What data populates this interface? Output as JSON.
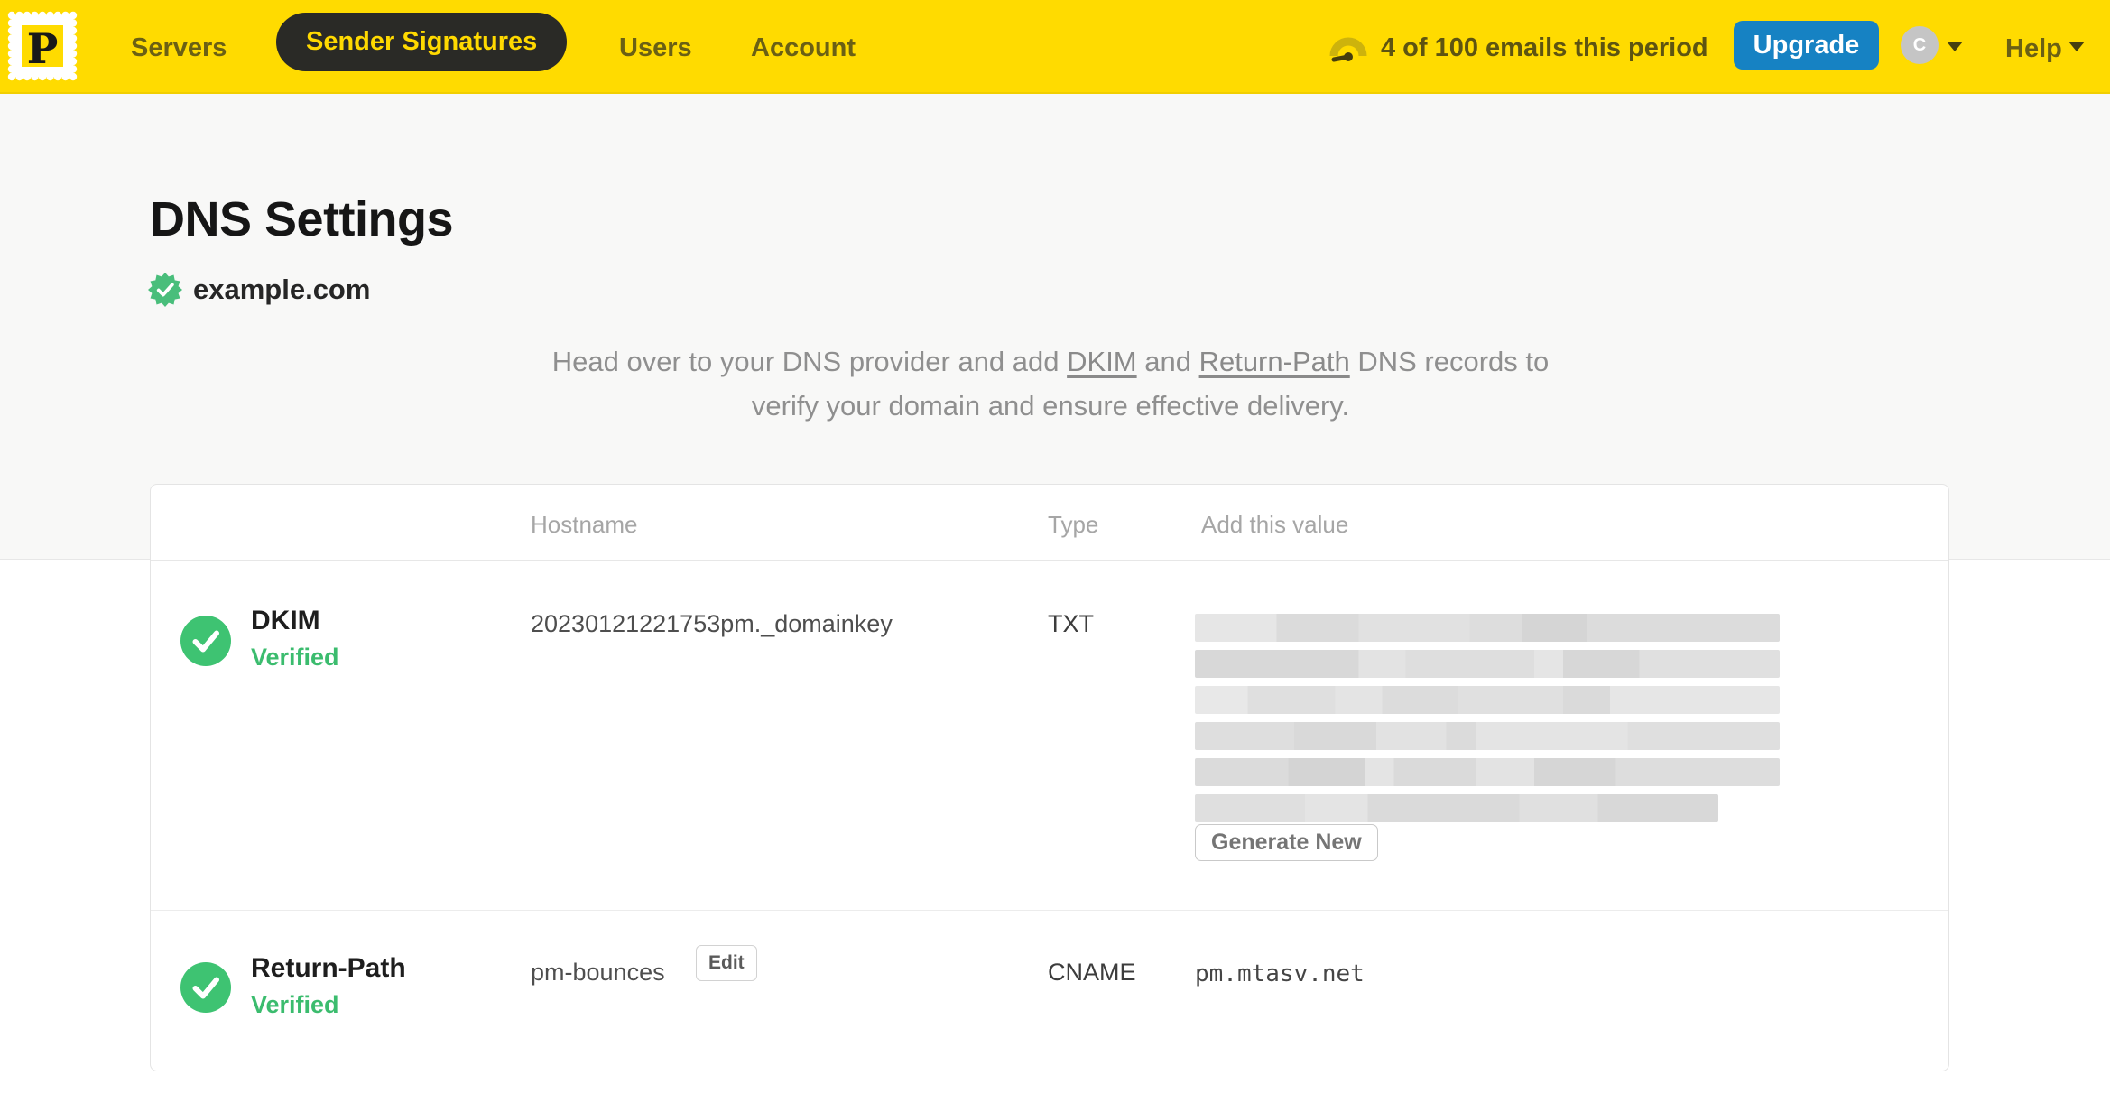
{
  "brand": {
    "logo_letter": "P"
  },
  "nav": {
    "items": [
      {
        "label": "Servers",
        "active": false
      },
      {
        "label": "Sender Signatures",
        "active": true
      },
      {
        "label": "Users",
        "active": false
      },
      {
        "label": "Account",
        "active": false
      }
    ],
    "usage_text": "4 of 100 emails this period",
    "upgrade_label": "Upgrade",
    "avatar_initial": "C",
    "help_label": "Help"
  },
  "page": {
    "title": "DNS Settings",
    "domain": "example.com",
    "description": {
      "p1": "Head over to your DNS provider and add ",
      "link_dkim": "DKIM",
      "p2": " and ",
      "link_return_path": "Return-Path",
      "p3": " DNS records to",
      "p4": "verify your domain and ensure effective delivery."
    }
  },
  "table": {
    "headers": {
      "hostname": "Hostname",
      "type": "Type",
      "value": "Add this value"
    },
    "rows": [
      {
        "name": "DKIM",
        "status": "Verified",
        "hostname": "20230121221753pm._domainkey",
        "type": "TXT",
        "value_redacted": true,
        "action_label": "Generate New"
      },
      {
        "name": "Return-Path",
        "status": "Verified",
        "hostname": "pm-bounces",
        "edit_label": "Edit",
        "type": "CNAME",
        "value": "pm.mtasv.net"
      }
    ]
  },
  "colors": {
    "brand_yellow": "#FFDB00",
    "nav_pill_bg": "#2A2A26",
    "nav_text": "#6B6014",
    "upgrade_blue": "#1682C3",
    "verified_green": "#3BBC6E",
    "badge_green": "#3EC372",
    "seal_green": "#49BE7B",
    "page_bg": "#F8F8F7"
  }
}
